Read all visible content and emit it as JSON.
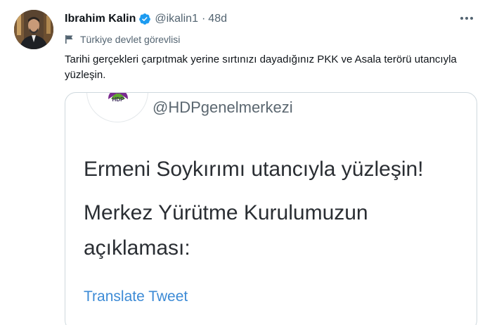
{
  "author": {
    "name": "Ibrahim Kalin",
    "handle": "@ikalin1",
    "separator": "·",
    "time": "48d"
  },
  "label": {
    "text": "Türkiye devlet görevlisi"
  },
  "tweet": {
    "text": "Tarihi gerçekleri çarpıtmak yerine sırtınızı dayadığınız PKK ve Asala terörü utancıyla yüzleşin."
  },
  "quote": {
    "logo_text": "HDP",
    "handle": "@HDPgenelmerkezi",
    "line1": "Ermeni Soykırımı utancıyla yüzleşin!",
    "line2": "Merkez Yürütme Kurulumuzun",
    "line3": "açıklaması:",
    "translate_label": "Translate Tweet"
  },
  "colors": {
    "verified": "#1d9bf0",
    "muted": "#536471",
    "link": "#3d8bd6",
    "hdp_purple": "#7a2b8f",
    "hdp_green": "#5fa82d"
  },
  "icons": {
    "verified": "verified-badge-icon",
    "more": "more-horizontal-icon",
    "flag": "flag-icon"
  }
}
